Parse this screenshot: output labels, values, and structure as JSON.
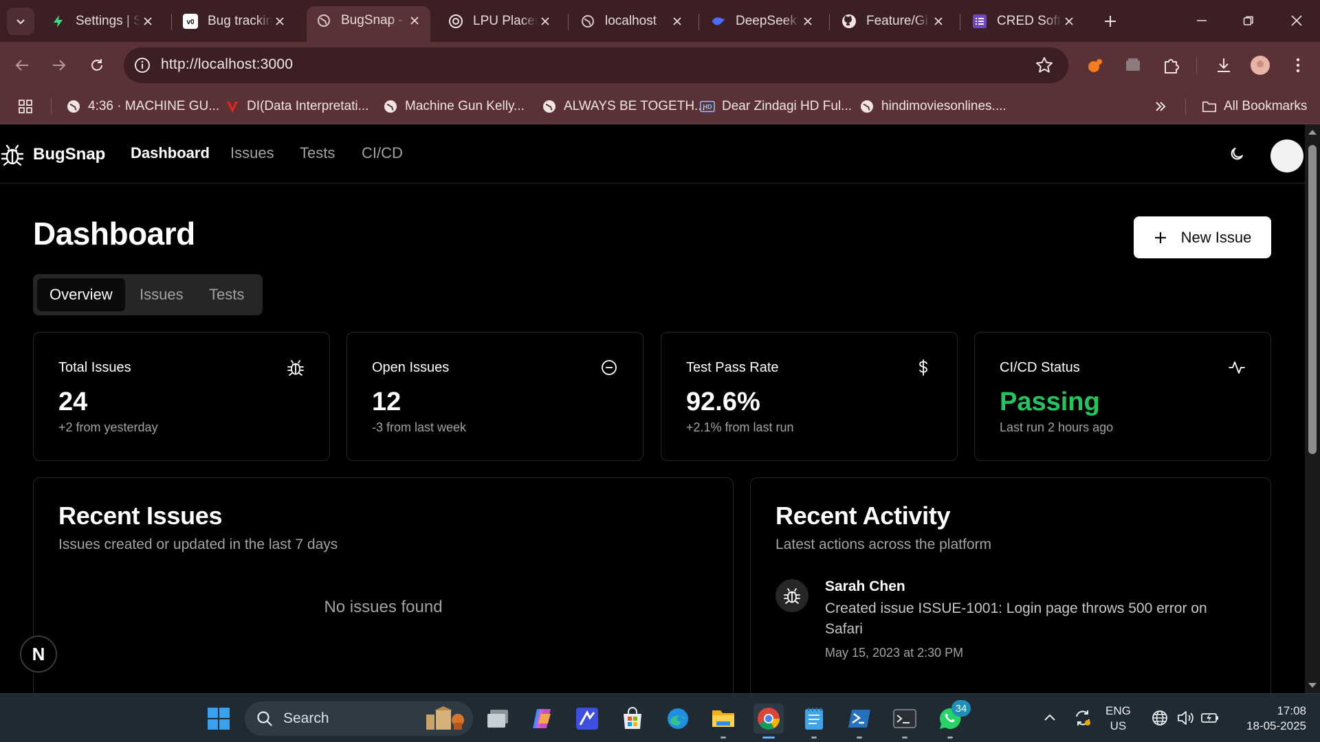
{
  "browser": {
    "tabs": [
      {
        "title": "Settings | S",
        "icon": "bolt-favicon",
        "active": false
      },
      {
        "title": "Bug trackin",
        "icon": "v0-favicon",
        "active": false
      },
      {
        "title": "BugSnap -",
        "icon": "globe-favicon",
        "active": true
      },
      {
        "title": "LPU Placem",
        "icon": "openai-favicon",
        "active": false
      },
      {
        "title": "localhost",
        "icon": "globe-favicon",
        "active": false
      },
      {
        "title": "DeepSeek",
        "icon": "deepseek-favicon",
        "active": false
      },
      {
        "title": "Feature/Gi",
        "icon": "github-favicon",
        "active": false
      },
      {
        "title": "CRED Softw",
        "icon": "forms-favicon",
        "active": false
      }
    ],
    "url": "http://localhost:3000",
    "bookmarks": [
      {
        "label": "4:36 · MACHINE GU...",
        "icon": "globe-icon"
      },
      {
        "label": "DI(Data Interpretati...",
        "icon": "red-v-icon"
      },
      {
        "label": "Machine Gun Kelly...",
        "icon": "globe-icon"
      },
      {
        "label": "ALWAYS BE TOGETH...",
        "icon": "globe-icon"
      },
      {
        "label": "Dear Zindagi HD Ful...",
        "icon": "hd-icon"
      },
      {
        "label": "hindimoviesonlines....",
        "icon": "globe-icon"
      }
    ],
    "all_bookmarks_label": "All Bookmarks"
  },
  "app": {
    "brand": "BugSnap",
    "nav": [
      "Dashboard",
      "Issues",
      "Tests",
      "CI/CD"
    ],
    "active_nav": "Dashboard",
    "page_title": "Dashboard",
    "new_issue_label": "New Issue",
    "tabs": [
      "Overview",
      "Issues",
      "Tests"
    ],
    "active_tab": "Overview",
    "stats": [
      {
        "label": "Total Issues",
        "value": "24",
        "sub": "+2 from yesterday",
        "icon": "bug-icon"
      },
      {
        "label": "Open Issues",
        "value": "12",
        "sub": "-3 from last week",
        "icon": "minus-circle-icon"
      },
      {
        "label": "Test Pass Rate",
        "value": "92.6%",
        "sub": "+2.1% from last run",
        "icon": "dollar-icon"
      },
      {
        "label": "CI/CD Status",
        "value": "Passing",
        "sub": "Last run 2 hours ago",
        "icon": "activity-icon",
        "value_color": "#22c55e"
      }
    ],
    "recent_issues": {
      "title": "Recent Issues",
      "subtitle": "Issues created or updated in the last 7 days",
      "empty": "No issues found"
    },
    "recent_activity": {
      "title": "Recent Activity",
      "subtitle": "Latest actions across the platform",
      "items": [
        {
          "user": "Sarah Chen",
          "text": "Created issue ISSUE-1001: Login page throws 500 error on Safari",
          "time": "May 15, 2023 at 2:30 PM"
        }
      ]
    },
    "framework_badge": "N"
  },
  "taskbar": {
    "search_label": "Search",
    "whatsapp_badge": "34",
    "lang_line1": "ENG",
    "lang_line2": "US",
    "time": "17:08",
    "date": "18-05-2025"
  },
  "colors": {
    "accent_green": "#22c55e",
    "tab_bg": "#3b1f23",
    "toolbar_bg": "#5a3236"
  }
}
